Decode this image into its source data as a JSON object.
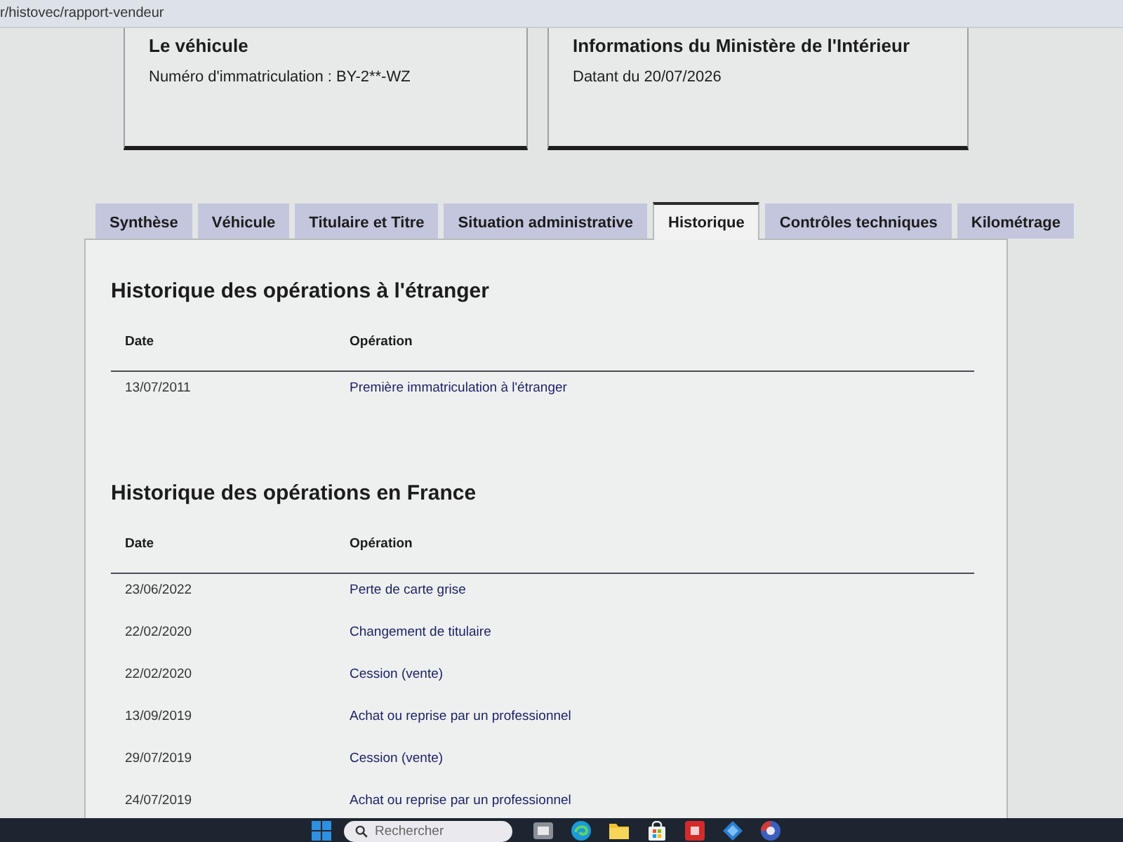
{
  "address_bar": {
    "url": "r/histovec/rapport-vendeur"
  },
  "cards": [
    {
      "title": "Le véhicule",
      "text": "Numéro d'immatriculation : BY-2**-WZ"
    },
    {
      "title": "Informations du Ministère de l'Intérieur",
      "text": "Datant du 20/07/2026"
    }
  ],
  "tabs": [
    {
      "label": "Synthèse",
      "selected": false
    },
    {
      "label": "Véhicule",
      "selected": false
    },
    {
      "label": "Titulaire et Titre",
      "selected": false
    },
    {
      "label": "Situation administrative",
      "selected": false
    },
    {
      "label": "Historique",
      "selected": true
    },
    {
      "label": "Contrôles techniques",
      "selected": false
    },
    {
      "label": "Kilométrage",
      "selected": false
    }
  ],
  "sections": [
    {
      "title": "Historique des opérations à l'étranger",
      "columns": [
        "Date",
        "Opération"
      ],
      "rows": [
        {
          "date": "13/07/2011",
          "operation": "Première immatriculation à l'étranger"
        }
      ]
    },
    {
      "title": "Historique des opérations en France",
      "columns": [
        "Date",
        "Opération"
      ],
      "rows": [
        {
          "date": "23/06/2022",
          "operation": "Perte de carte grise"
        },
        {
          "date": "22/02/2020",
          "operation": "Changement de titulaire"
        },
        {
          "date": "22/02/2020",
          "operation": "Cession (vente)"
        },
        {
          "date": "13/09/2019",
          "operation": "Achat ou reprise par un professionnel"
        },
        {
          "date": "29/07/2019",
          "operation": "Cession (vente)"
        },
        {
          "date": "24/07/2019",
          "operation": "Achat ou reprise par un professionnel"
        }
      ]
    }
  ],
  "taskbar": {
    "search": {
      "placeholder": "Rechercher"
    }
  }
}
